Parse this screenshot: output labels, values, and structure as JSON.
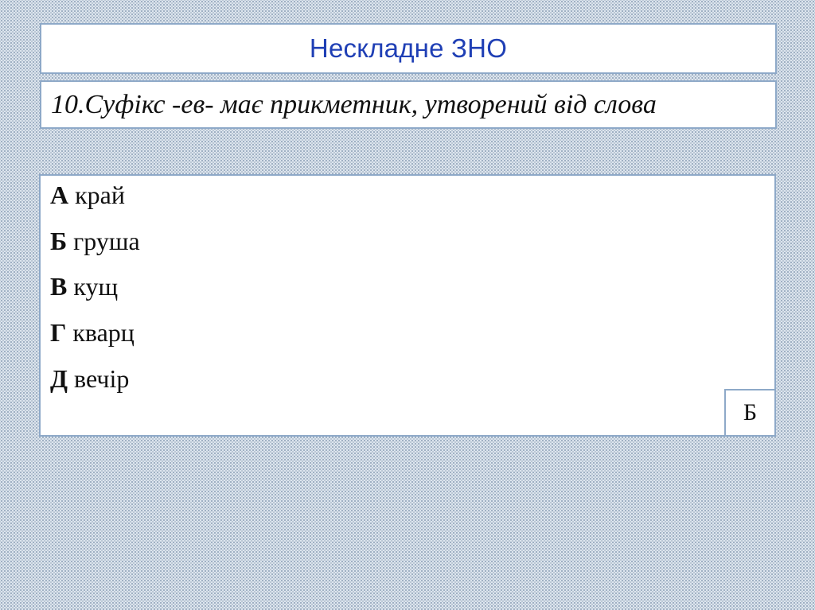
{
  "slide": {
    "title": "Нескладне ЗНО",
    "question": "10.Суфікс -ев- має прикметник, утворений від слова",
    "options": [
      {
        "letter": "А",
        "word": "край"
      },
      {
        "letter": "Б",
        "word": "груша"
      },
      {
        "letter": "В",
        "word": "кущ"
      },
      {
        "letter": "Г",
        "word": "кварц"
      },
      {
        "letter": "Д",
        "word": "вечір"
      }
    ],
    "answer": "Б"
  },
  "colors": {
    "title_text": "#1f3fb5",
    "box_border": "#8ea9c8",
    "background": "#dde5ee"
  }
}
